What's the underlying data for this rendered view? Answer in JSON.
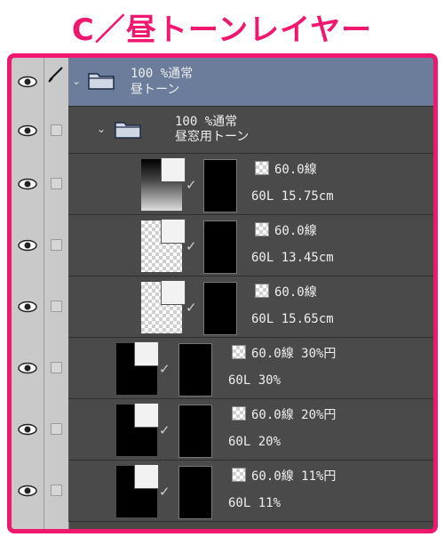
{
  "title": "C／昼トーンレイヤー",
  "icons": {
    "eye": "eye-icon",
    "pen": "pen-icon",
    "folder": "folder-icon",
    "chevron": "chevron-down-icon",
    "checkbox": "checkbox-icon"
  },
  "colors": {
    "accent": "#f0186e",
    "selected_row": "#6b7d9b",
    "panel": "#484848"
  },
  "folders": [
    {
      "blend": "100 %通常",
      "name": "昼トーン"
    },
    {
      "blend": "100 %通常",
      "name": "昼窓用トーン"
    }
  ],
  "tone_layers": [
    {
      "tone": "60.0線",
      "detail": "60L 15.75cm"
    },
    {
      "tone": "60.0線",
      "detail": "60L 13.45cm"
    },
    {
      "tone": "60.0線",
      "detail": "60L 15.65cm"
    },
    {
      "tone": "60.0線 30%円",
      "detail": "60L 30%"
    },
    {
      "tone": "60.0線 20%円",
      "detail": "60L 20%"
    },
    {
      "tone": "60.0線 11%円",
      "detail": "60L 11%"
    }
  ]
}
